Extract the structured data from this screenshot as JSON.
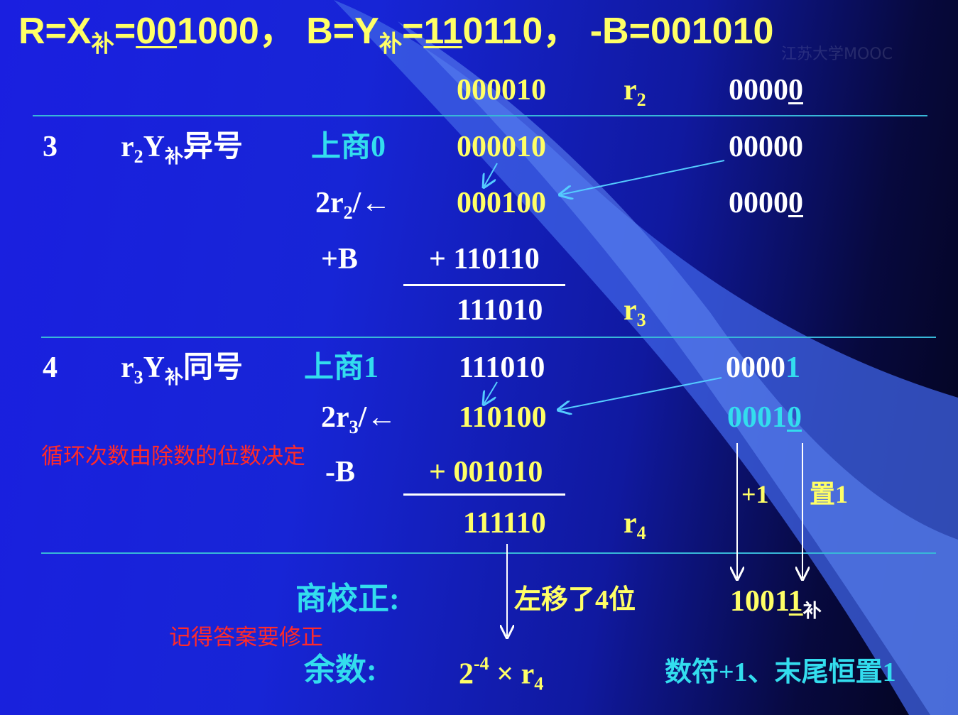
{
  "header": {
    "r_label": "R=X",
    "sub_bu": "补",
    "r_eq": "=",
    "r_val_underlined": "00",
    "r_val_rest": "1000，",
    "b_label": "B=Y",
    "b_eq": "=",
    "b_val_underlined": "11",
    "b_val_rest": "0110，",
    "negb": "-B=001010"
  },
  "watermark": "江苏大学MOOC",
  "row_r2": {
    "value": "000010",
    "label_r": "r",
    "label_sub": "2",
    "q_plain": "0000",
    "q_underlined": "0"
  },
  "step3": {
    "num": "3",
    "cond_r": "r",
    "cond_r_sub": "2",
    "cond_y": "Y",
    "cond_y_sub": "补",
    "cond_text": "异号",
    "action": "上商0",
    "val1": "000010",
    "q1": "00000",
    "shift_label_pre": "2r",
    "shift_label_sub": "2",
    "shift_label_post": "/←",
    "val2": "000100",
    "q2_plain": "0000",
    "q2_underlined": "0",
    "op": "+B",
    "add_val": "+ 110110",
    "result": "111010",
    "result_r": "r",
    "result_sub": "3"
  },
  "step4": {
    "num": "4",
    "cond_r": "r",
    "cond_r_sub": "3",
    "cond_y": "Y",
    "cond_y_sub": "补",
    "cond_text": "同号",
    "action": "上商1",
    "val1": "111010",
    "q1_plain": "0000",
    "q1_cyan": "1",
    "shift_label_pre": "2r",
    "shift_label_sub": "3",
    "shift_label_post": "/←",
    "val2": "110100",
    "q2_plain": "0001",
    "q2_underlined": "0",
    "op": "-B",
    "add_val": "+ 001010",
    "result": "111110",
    "result_r": "r",
    "result_sub": "4",
    "plus1": "+1",
    "set1": "置1"
  },
  "note_red_1": "循环次数由除数的位数决定",
  "note_red_2": "记得答案要修正",
  "correction": {
    "label": "商校正:",
    "shift_note": "左移了4位",
    "quotient_plain": "1001",
    "quotient_underlined": "1",
    "quotient_sub": "补"
  },
  "remainder": {
    "label": "余数:",
    "base": "2",
    "exp": "-4",
    "times": "×",
    "r": "r",
    "r_sub": "4",
    "note": "数符+1、末尾恒置1"
  }
}
